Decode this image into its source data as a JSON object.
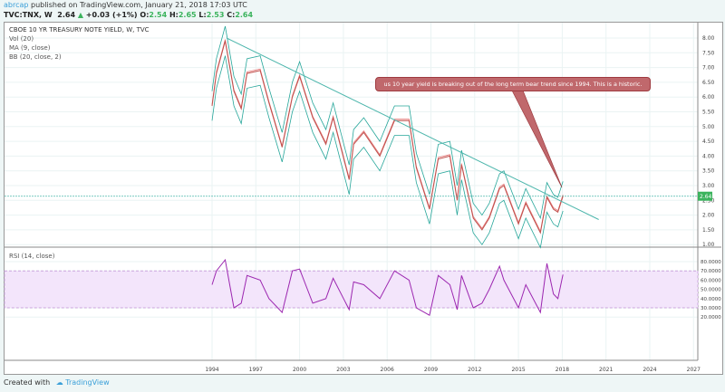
{
  "header": {
    "user": "abrcap",
    "published": "published on TradingView.com, January 21, 2018 17:03 UTC"
  },
  "quote": {
    "symbol": "TVC:TNX, W",
    "last": "2.64",
    "change": "+0.03 (+1%)",
    "o_label": "O:",
    "o": "2.54",
    "h_label": "H:",
    "h": "2.65",
    "l_label": "L:",
    "l": "2.53",
    "c_label": "C:",
    "c": "2.64"
  },
  "legend": {
    "title": "CBOE 10 YR TREASURY NOTE YIELD, W, TVC",
    "vol": "Vol (20)",
    "ma": "MA (9, close)",
    "bb": "BB (20, close, 2)",
    "rsi": "RSI (14, close)"
  },
  "annotation": "us 10 year yield is breaking out of the long term bear trend since 1994. This is a historic.",
  "footer": {
    "created": "Created with",
    "brand": "TradingView"
  },
  "colors": {
    "price": "#c0504d",
    "bands": "#26a69a",
    "ma": "#e57373",
    "trend": "#4db6ac",
    "rsi": "#9c27b0",
    "rsi_band": "#f3e5fb",
    "last": "#3bb35d",
    "callout": "#c0686c"
  },
  "chart_data": [
    {
      "type": "line",
      "title": "CBOE 10 YR TREASURY NOTE YIELD, W, TVC",
      "ylim": [
        0.8,
        8.3
      ],
      "yticks": [
        "8.00",
        "7.50",
        "7.00",
        "6.50",
        "6.00",
        "5.50",
        "5.00",
        "4.50",
        "4.00",
        "3.50",
        "3.00",
        "2.50",
        "2.00",
        "1.50",
        "1.00"
      ],
      "xticks": [
        "1994",
        "1997",
        "2000",
        "2003",
        "2006",
        "2009",
        "2012",
        "2015",
        "2018",
        "2021",
        "2024",
        "2027"
      ],
      "last_value_label": "2.64",
      "x": [
        1994.0,
        1994.3,
        1994.9,
        1995.5,
        1996.0,
        1996.4,
        1997.3,
        1997.9,
        1998.8,
        1999.5,
        2000.0,
        2000.9,
        2001.8,
        2002.3,
        2003.4,
        2003.7,
        2004.4,
        2005.5,
        2006.5,
        2007.5,
        2008.0,
        2008.9,
        2009.5,
        2010.3,
        2010.8,
        2011.1,
        2011.9,
        2012.5,
        2013.0,
        2013.7,
        2014.0,
        2015.0,
        2015.5,
        2016.5,
        2016.95,
        2017.4,
        2017.7,
        2018.05
      ],
      "series": [
        {
          "values": [
            5.7,
            6.8,
            7.9,
            6.2,
            5.6,
            6.8,
            6.9,
            5.8,
            4.3,
            6.0,
            6.7,
            5.3,
            4.4,
            5.3,
            3.2,
            4.4,
            4.8,
            4.0,
            5.2,
            5.2,
            3.6,
            2.2,
            3.9,
            4.0,
            2.5,
            3.7,
            1.9,
            1.5,
            1.9,
            2.9,
            3.0,
            1.7,
            2.4,
            1.4,
            2.6,
            2.2,
            2.1,
            2.64
          ]
        }
      ],
      "trendline": {
        "from": [
          1995.0,
          8.0
        ],
        "to": [
          2020.5,
          1.85
        ]
      },
      "horizontal_line": 2.64
    },
    {
      "type": "line",
      "title": "RSI (14, close)",
      "ylim": [
        10,
        85
      ],
      "yticks": [
        "80.0000",
        "70.0000",
        "60.0000",
        "50.0000",
        "40.0000",
        "30.0000",
        "20.0000"
      ],
      "band": [
        30,
        70
      ],
      "x": [
        1994.0,
        1994.3,
        1994.9,
        1995.5,
        1996.0,
        1996.4,
        1997.3,
        1997.9,
        1998.8,
        1999.5,
        2000.0,
        2000.9,
        2001.8,
        2002.3,
        2003.4,
        2003.7,
        2004.4,
        2005.5,
        2006.5,
        2007.5,
        2008.0,
        2008.9,
        2009.5,
        2010.3,
        2010.8,
        2011.1,
        2011.9,
        2012.5,
        2013.0,
        2013.7,
        2014.0,
        2015.0,
        2015.5,
        2016.5,
        2016.95,
        2017.4,
        2017.7,
        2018.05
      ],
      "series": [
        {
          "values": [
            55,
            70,
            82,
            30,
            35,
            65,
            60,
            40,
            25,
            70,
            72,
            35,
            40,
            62,
            28,
            58,
            55,
            40,
            70,
            60,
            30,
            22,
            65,
            55,
            28,
            65,
            30,
            35,
            50,
            75,
            60,
            30,
            55,
            25,
            78,
            45,
            40,
            66
          ]
        }
      ]
    }
  ]
}
